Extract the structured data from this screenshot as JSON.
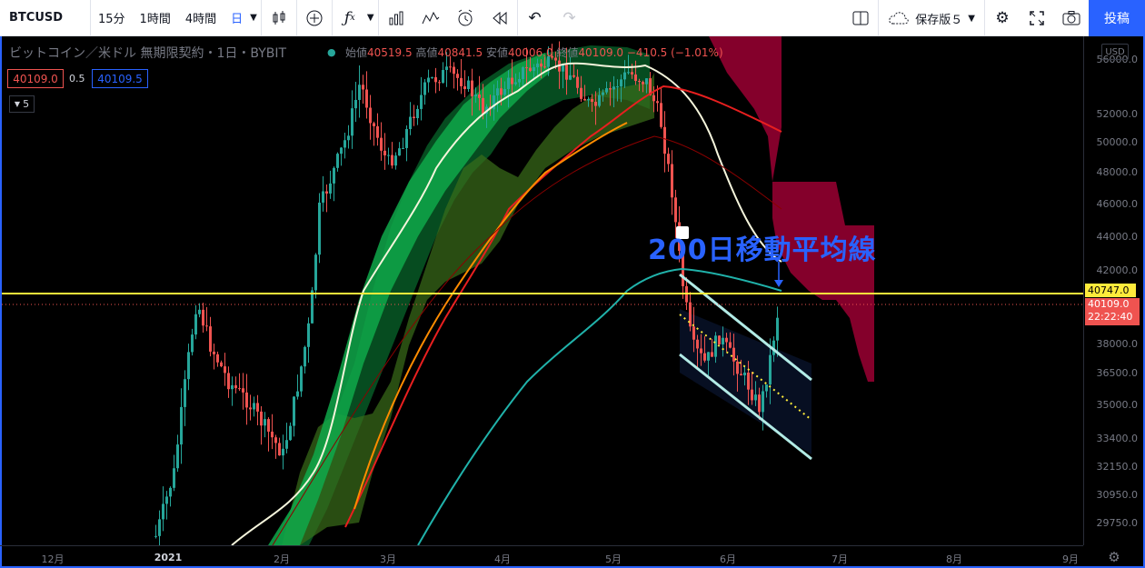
{
  "toolbar": {
    "symbol": "BTCUSD",
    "timeframes": [
      "15分",
      "1時間",
      "4時間",
      "日"
    ],
    "active_timeframe": "日",
    "save_label": "保存版５",
    "publish_label": "投稿"
  },
  "legend": {
    "title": "ビットコイン／米ドル 無期限契約・1日・BYBIT",
    "open_label": "始値",
    "open": "40519.5",
    "high_label": "高値",
    "high": "40841.5",
    "low_label": "安値",
    "low": "40006.0",
    "close_label": "終値",
    "close": "40109.0",
    "change": "−410.5 (−1.01%)",
    "bid": "40109.0",
    "spread": "0.5",
    "ask": "40109.5",
    "collapse_count": "5"
  },
  "annotation": "200日移動平均線",
  "price_axis": {
    "currency": "USD",
    "ticks": [
      "56000.0",
      "52000.0",
      "50000.0",
      "48000.0",
      "46000.0",
      "44000.0",
      "42000.0",
      "38000.0",
      "36500.0",
      "35000.0",
      "33400.0",
      "32150.0",
      "30950.0",
      "29750.0"
    ],
    "horizontal_line_label": "40747.0",
    "last_price": "40109.0",
    "countdown": "22:22:40"
  },
  "time_axis": {
    "ticks": [
      "12月",
      "2021",
      "2月",
      "3月",
      "4月",
      "5月",
      "6月",
      "7月",
      "8月",
      "9月"
    ]
  },
  "colors": {
    "up": "#26a69a",
    "down": "#ef5350",
    "accent": "#2962ff",
    "hline": "#ffeb3b",
    "ma_white": "#f5f5dc",
    "ma_red": "#e81f1f",
    "ma_cyan": "#20b2aa",
    "ma_orange": "#ff8c00"
  }
}
